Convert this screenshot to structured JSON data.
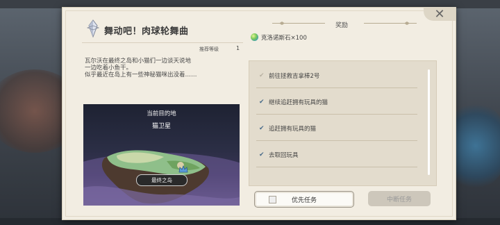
{
  "quest": {
    "title": "舞动吧！肉球轮舞曲",
    "recommend_label": "推荐等级",
    "recommend_value": "1",
    "description": [
      "瓦尔沃在最终之岛和小猫们一边谈天说地",
      "一边吃着小鱼干。",
      "似乎最近在岛上有一些神秘猫咪出没着……"
    ]
  },
  "map": {
    "current_label": "当前目的地",
    "destination": "猫卫星",
    "node_label": "最终之岛"
  },
  "reward": {
    "header": "奖励",
    "item": "克洛诺斯石×100",
    "icon": "chronos-stone-icon"
  },
  "tasks": [
    {
      "label": "前往拯救吉拿棒2号",
      "done": false
    },
    {
      "label": "继续追赶拥有玩具的猫",
      "done": true
    },
    {
      "label": "追赶拥有玩具的猫",
      "done": true
    },
    {
      "label": "去取回玩具",
      "done": true
    }
  ],
  "buttons": {
    "priority": "优先任务",
    "abort": "中断任务",
    "close": "✕"
  },
  "colors": {
    "panel": "#f2ede2",
    "check": "#4a6c8a",
    "list_bg": "#e3dccd"
  }
}
